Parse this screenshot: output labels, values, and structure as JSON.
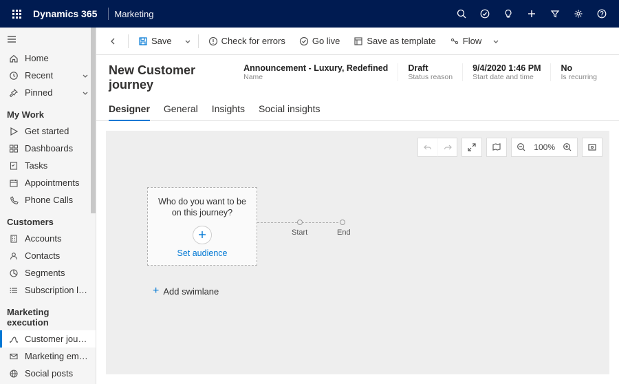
{
  "appbar": {
    "brand": "Dynamics 365",
    "module": "Marketing"
  },
  "sidebar": {
    "quick": [
      {
        "label": "Home",
        "icon": "home"
      },
      {
        "label": "Recent",
        "icon": "clock",
        "chev": true
      },
      {
        "label": "Pinned",
        "icon": "pin",
        "chev": true
      }
    ],
    "groups": [
      {
        "title": "My Work",
        "items": [
          {
            "label": "Get started",
            "icon": "play"
          },
          {
            "label": "Dashboards",
            "icon": "dash"
          },
          {
            "label": "Tasks",
            "icon": "task"
          },
          {
            "label": "Appointments",
            "icon": "cal"
          },
          {
            "label": "Phone Calls",
            "icon": "phone"
          }
        ]
      },
      {
        "title": "Customers",
        "items": [
          {
            "label": "Accounts",
            "icon": "building"
          },
          {
            "label": "Contacts",
            "icon": "person"
          },
          {
            "label": "Segments",
            "icon": "segment"
          },
          {
            "label": "Subscription lists",
            "icon": "list"
          }
        ]
      },
      {
        "title": "Marketing execution",
        "items": [
          {
            "label": "Customer journeys",
            "icon": "journey",
            "active": true
          },
          {
            "label": "Marketing emails",
            "icon": "mail"
          },
          {
            "label": "Social posts",
            "icon": "social"
          }
        ]
      }
    ]
  },
  "cmdbar": {
    "back": true,
    "save": "Save",
    "check": "Check for errors",
    "golive": "Go live",
    "template": "Save as template",
    "flow": "Flow"
  },
  "record": {
    "title": "New Customer journey",
    "fields": [
      {
        "value": "Announcement - Luxury, Redefined",
        "label": "Name"
      },
      {
        "value": "Draft",
        "label": "Status reason"
      },
      {
        "value": "9/4/2020 1:46 PM",
        "label": "Start date and time"
      },
      {
        "value": "No",
        "label": "Is recurring"
      }
    ]
  },
  "tabs": [
    "Designer",
    "General",
    "Insights",
    "Social insights"
  ],
  "active_tab": 0,
  "canvas": {
    "audience_prompt": "Who do you want to be on this journey?",
    "set_audience": "Set audience",
    "start": "Start",
    "end": "End",
    "add_swimlane": "Add swimlane",
    "zoom": "100%"
  }
}
